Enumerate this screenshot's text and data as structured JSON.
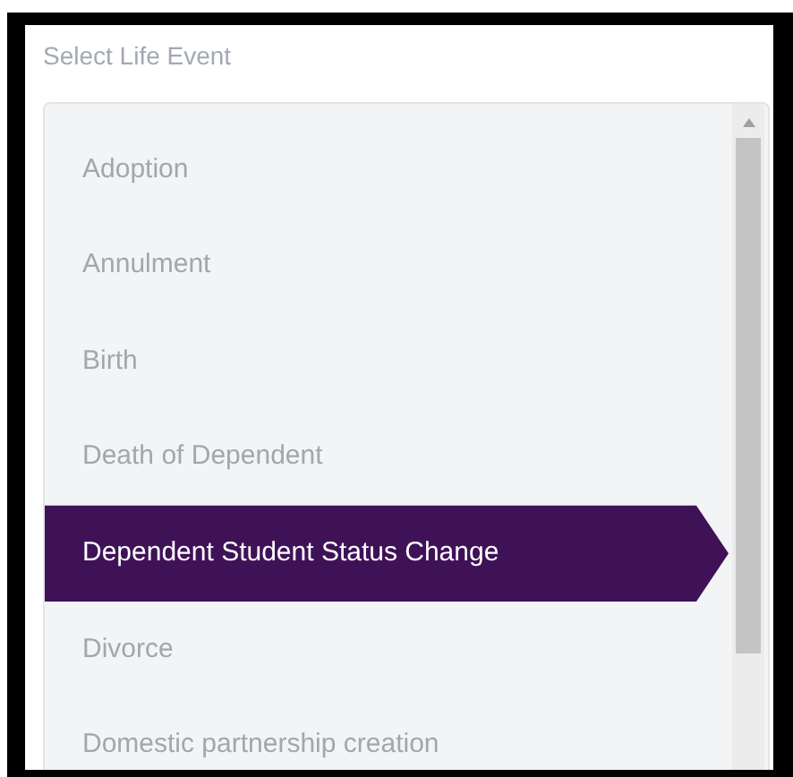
{
  "label": "Select Life Event",
  "life_events": [
    {
      "label": "Adoption",
      "selected": false
    },
    {
      "label": "Annulment",
      "selected": false
    },
    {
      "label": "Birth",
      "selected": false
    },
    {
      "label": "Death of Dependent",
      "selected": false
    },
    {
      "label": "Dependent Student Status Change",
      "selected": true
    },
    {
      "label": "Divorce",
      "selected": false
    },
    {
      "label": "Domestic partnership creation",
      "selected": false
    }
  ]
}
